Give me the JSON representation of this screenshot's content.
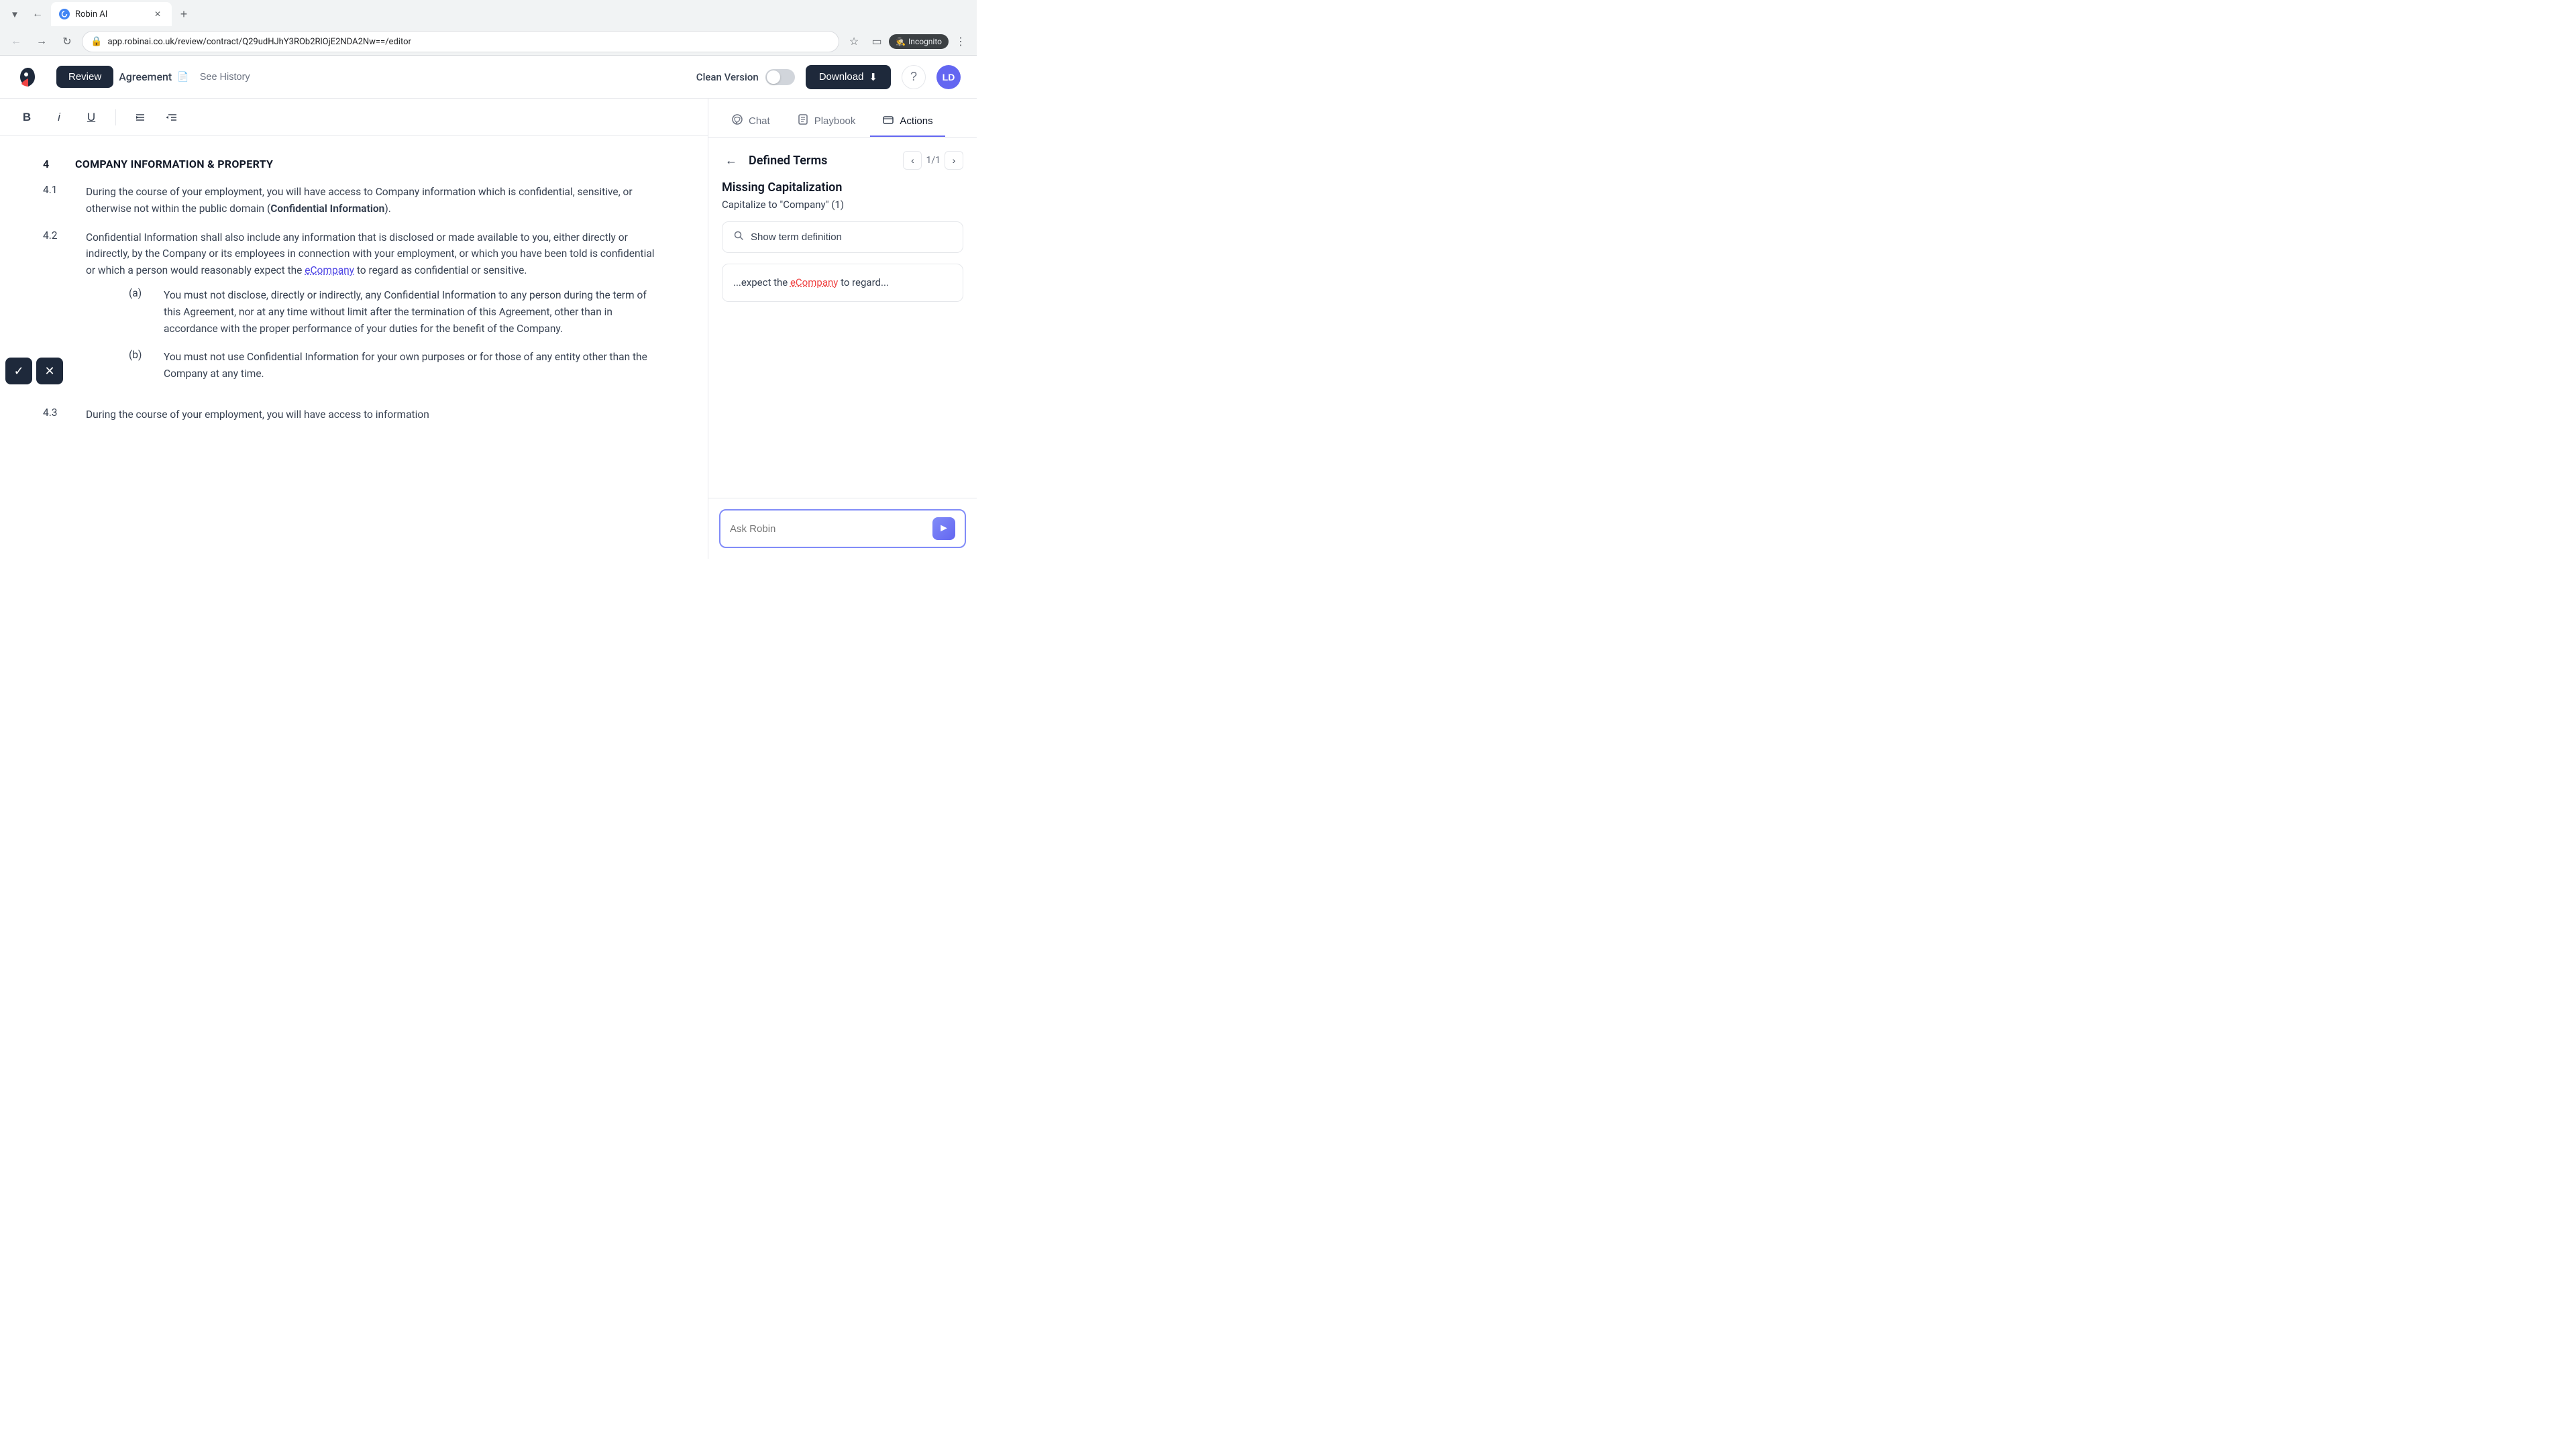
{
  "browser": {
    "tab_title": "Robin AI",
    "url": "app.robinai.co.uk/review/contract/Q29udHJhY3ROb2RlOjE2NDA2Nw==/editor",
    "incognito_label": "Incognito"
  },
  "header": {
    "review_label": "Review",
    "agreement_label": "Agreement",
    "see_history_label": "See History",
    "clean_version_label": "Clean Version",
    "download_label": "Download",
    "avatar_label": "LD"
  },
  "toolbar": {
    "bold_label": "B",
    "italic_label": "i",
    "underline_label": "U"
  },
  "document": {
    "section_num": "4",
    "section_title": "COMPANY INFORMATION & PROPERTY",
    "clause_4_1_num": "4.1",
    "clause_4_1_text_1": "During the course of your employment, you will have access to Company information which is confidential, sensitive, or otherwise not within the public domain (",
    "clause_4_1_bold": "Confidential Information",
    "clause_4_1_text_2": ").",
    "clause_4_2_num": "4.2",
    "clause_4_2_text_1": "Confidential Information shall also include any information that is disclosed or made available to you, either directly or indirectly, by the Company or its employees in connection with your employment, or which you have been told is confidential or which a person would reasonably expect the ",
    "clause_4_2_highlight": "eCompany",
    "clause_4_2_text_2": " to regard as confidential or sensitive.",
    "sub_a_label": "(a)",
    "sub_a_text": "You must not disclose, directly or indirectly, any Confidential Information to any person during the term of this Agreement, nor at any time without limit after the termination of this Agreement, other than in accordance with the proper performance of your duties for the benefit of the Company.",
    "sub_b_label": "(b)",
    "sub_b_text": "You must not use Confidential Information for your own purposes or for those of any entity other than the Company at any time.",
    "clause_4_3_num": "4.3",
    "clause_4_3_text": "During the course of your employment, you will have access to information"
  },
  "panel": {
    "chat_tab_label": "Chat",
    "playbook_tab_label": "Playbook",
    "actions_tab_label": "Actions",
    "section_title": "Defined Terms",
    "page_indicator": "1/1",
    "missing_cap_title": "Missing Capitalization",
    "missing_cap_desc": "Capitalize to \"Company\" (1)",
    "show_term_label": "Show term definition",
    "context_text_before": "...expect the ",
    "context_highlight": "eCompany",
    "context_text_after": " to regard...",
    "ask_robin_placeholder": "Ask Robin"
  },
  "actions": {
    "accept_label": "✓",
    "reject_label": "✕"
  }
}
